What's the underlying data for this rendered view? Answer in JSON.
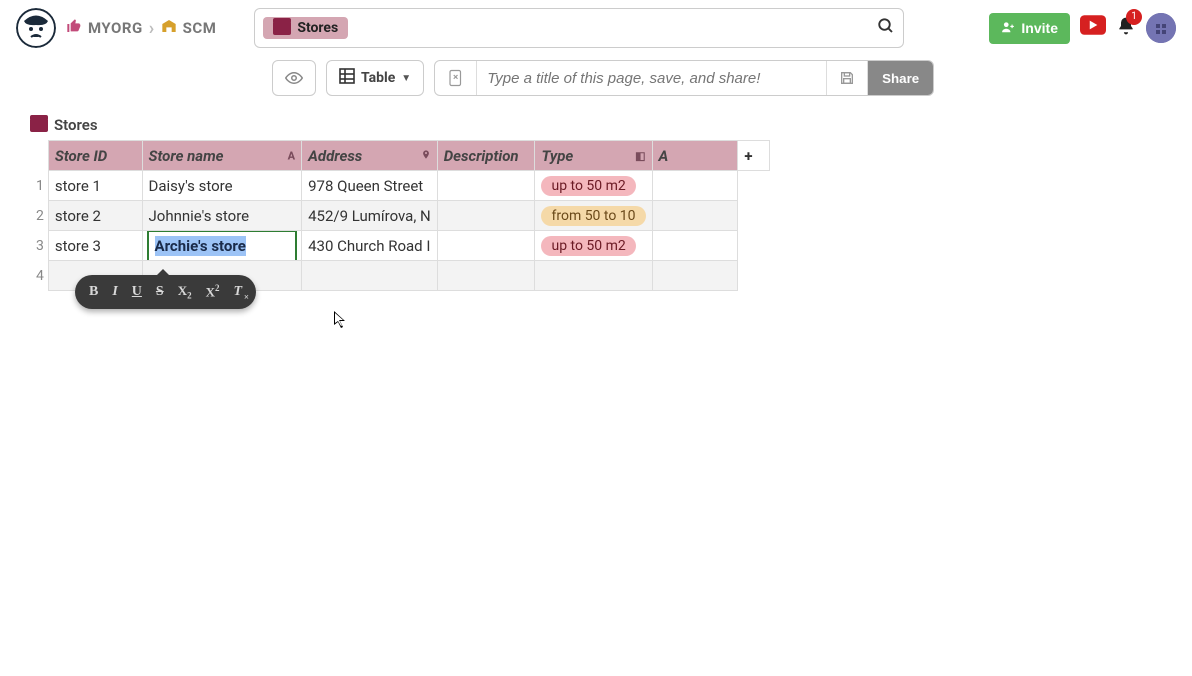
{
  "breadcrumb": {
    "org": "MYORG",
    "project": "SCM"
  },
  "search": {
    "chip_label": "Stores"
  },
  "invite_label": "Invite",
  "bell_badge": "1",
  "subbar": {
    "view_label": "Table",
    "title_placeholder": "Type a title of this page, save, and share!",
    "share_label": "Share"
  },
  "table": {
    "title": "Stores",
    "columns": {
      "store_id": "Store ID",
      "store_name": "Store name",
      "address": "Address",
      "description": "Description",
      "type": "Type",
      "extra": "A"
    },
    "col_type_letters": {
      "store_name": "A",
      "type": "◧"
    },
    "rows": [
      {
        "num": "1",
        "id": "store 1",
        "name": "Daisy's store",
        "addr": "978 Queen Street",
        "descr": "",
        "type": "up to 50 m2",
        "type_style": "red"
      },
      {
        "num": "2",
        "id": "store 2",
        "name": "Johnnie's store",
        "addr": "452/9 Lumírova, N",
        "descr": "",
        "type": "from 50 to 10",
        "type_style": "orange"
      },
      {
        "num": "3",
        "id": "store 3",
        "name": "Archie's store",
        "addr": "430 Church Road I",
        "descr": "",
        "type": "up to 50 m2",
        "type_style": "red"
      }
    ],
    "empty_row_num": "4",
    "editing_cell_value": "Archie's store"
  },
  "format_toolbar": {
    "bold": "B",
    "italic": "I",
    "underline": "U",
    "strike": "S",
    "sub": "X",
    "sub_suffix": "2",
    "sup": "X",
    "sup_suffix": "2",
    "clear": "T"
  }
}
